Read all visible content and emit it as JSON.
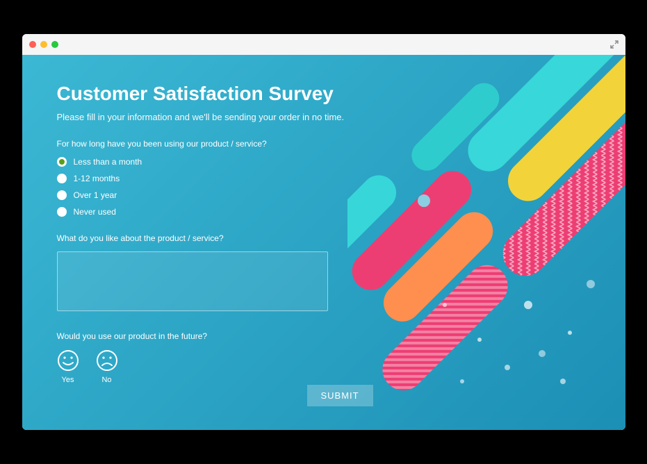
{
  "title": "Customer Satisfaction Survey",
  "subtitle": "Please fill in your information and we'll be sending your order in no time.",
  "q1": {
    "prompt": "For how long have you been using our product / service?",
    "options": [
      {
        "label": "Less than a month",
        "selected": true
      },
      {
        "label": "1-12 months",
        "selected": false
      },
      {
        "label": "Over 1 year",
        "selected": false
      },
      {
        "label": "Never used",
        "selected": false
      }
    ]
  },
  "q2": {
    "prompt": "What do you like about the product / service?",
    "value": ""
  },
  "q3": {
    "prompt": "Would you use our product in the future?",
    "options": [
      {
        "label": "Yes"
      },
      {
        "label": "No"
      }
    ]
  },
  "submit_label": "SUBMIT"
}
